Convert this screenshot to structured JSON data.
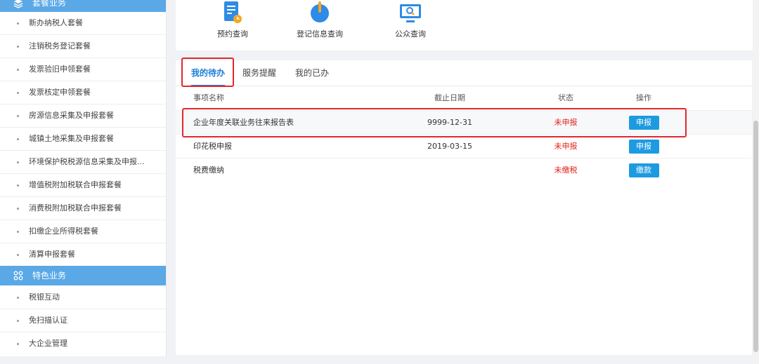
{
  "sidebar": {
    "section1_title": "套餐业务",
    "section1_items": [
      {
        "label": "新办纳税人套餐"
      },
      {
        "label": "注销税务登记套餐"
      },
      {
        "label": "发票验旧申领套餐"
      },
      {
        "label": "发票核定申领套餐"
      },
      {
        "label": "房源信息采集及申报套餐"
      },
      {
        "label": "城镇土地采集及申报套餐"
      },
      {
        "label": "环境保护税税源信息采集及申报..."
      },
      {
        "label": "增值税附加税联合申报套餐"
      },
      {
        "label": "消费税附加税联合申报套餐"
      },
      {
        "label": "扣缴企业所得税套餐"
      },
      {
        "label": "清算申报套餐"
      }
    ],
    "section2_title": "特色业务",
    "section2_items": [
      {
        "label": "税银互动"
      },
      {
        "label": "免扫描认证"
      },
      {
        "label": "大企业管理"
      }
    ]
  },
  "quick_links": [
    {
      "label": "预约查询",
      "icon": "calendar-doc-icon",
      "color": "#2e8be6"
    },
    {
      "label": "登记信息查询",
      "icon": "power-icon",
      "color": "#2e8be6"
    },
    {
      "label": "公众查询",
      "icon": "monitor-search-icon",
      "color": "#2e8be6"
    }
  ],
  "tabs": [
    {
      "label": "我的待办",
      "active": true
    },
    {
      "label": "服务提醒",
      "active": false
    },
    {
      "label": "我的已办",
      "active": false
    }
  ],
  "table": {
    "headers": {
      "name": "事项名称",
      "date": "截止日期",
      "status": "状态",
      "op": "操作"
    },
    "rows": [
      {
        "name": "企业年度关联业务往来报告表",
        "date": "9999-12-31",
        "status": "未申报",
        "action": "申报"
      },
      {
        "name": "印花税申报",
        "date": "2019-03-15",
        "status": "未申报",
        "action": "申报"
      },
      {
        "name": "税费缴纳",
        "date": "",
        "status": "未缴税",
        "action": "缴款"
      }
    ]
  },
  "colors": {
    "accent": "#1e7fd6",
    "button": "#1e9be0",
    "alert": "#e2231a",
    "sidebar_header": "#5aa8e6"
  }
}
